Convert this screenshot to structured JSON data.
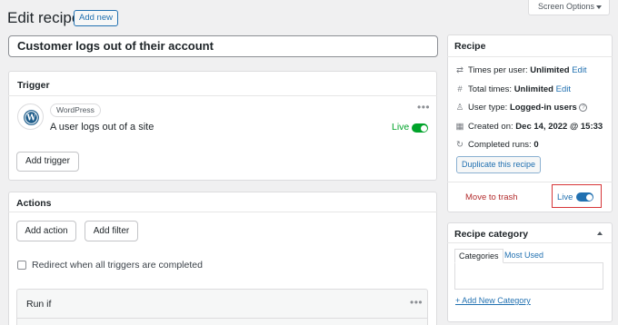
{
  "header": {
    "title": "Edit recipe",
    "add_new": "Add new",
    "screen_options": "Screen Options"
  },
  "recipe_title": "Customer logs out of their account",
  "trigger": {
    "heading": "Trigger",
    "integration": "WordPress",
    "description": "A user logs out of a site",
    "status": "Live",
    "add_button": "Add trigger"
  },
  "actions": {
    "heading": "Actions",
    "add_action": "Add action",
    "add_filter": "Add filter",
    "redirect_label": "Redirect when all triggers are completed",
    "run_if": "Run if"
  },
  "recipe_box": {
    "heading": "Recipe",
    "times_per_user_label": "Times per user:",
    "times_per_user_value": "Unlimited",
    "total_times_label": "Total times:",
    "total_times_value": "Unlimited",
    "edit_link": "Edit",
    "user_type_label": "User type:",
    "user_type_value": "Logged-in users",
    "created_label": "Created on:",
    "created_value": "Dec 14, 2022 @ 15:33",
    "completed_label": "Completed runs:",
    "completed_value": "0",
    "duplicate_button": "Duplicate this recipe",
    "trash_link": "Move to trash",
    "status": "Live"
  },
  "category": {
    "heading": "Recipe category",
    "tab_all": "Categories",
    "tab_most_used": "Most Used",
    "add_link": "+ Add New Category"
  },
  "colors": {
    "accent": "#2271b1",
    "live_green": "#00a32a",
    "trash_red": "#b32d2e",
    "highlight": "#d63638"
  }
}
